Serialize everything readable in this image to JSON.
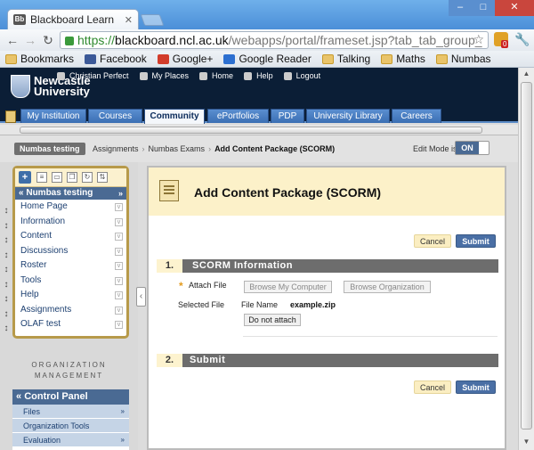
{
  "browser": {
    "tab_title": "Blackboard Learn",
    "tab_favicon": "Bb",
    "url": {
      "scheme": "https://",
      "host": "blackboard.ncl.ac.uk",
      "path": "/webapps/portal/frameset.jsp?tab_tab_group_"
    },
    "extension_badge": "0",
    "bookmarks": [
      {
        "label": "Bookmarks",
        "icon": "folder-icon"
      },
      {
        "label": "Facebook",
        "icon": "facebook-icon"
      },
      {
        "label": "Google+",
        "icon": "google-plus-icon"
      },
      {
        "label": "Google Reader",
        "icon": "google-reader-icon"
      },
      {
        "label": "Talking",
        "icon": "folder-icon"
      },
      {
        "label": "Maths",
        "icon": "folder-icon"
      },
      {
        "label": "Numbas",
        "icon": "folder-icon"
      }
    ]
  },
  "header": {
    "logo_line1": "Newcastle",
    "logo_line2": "University",
    "user": "Christian Perfect",
    "links": [
      "My Places",
      "Home",
      "Help",
      "Logout"
    ]
  },
  "tabs": [
    {
      "label": "My Institution",
      "active": false
    },
    {
      "label": "Courses",
      "active": false
    },
    {
      "label": "Community",
      "active": true
    },
    {
      "label": "ePortfolios",
      "active": false
    },
    {
      "label": "PDP",
      "active": false
    },
    {
      "label": "University Library",
      "active": false
    },
    {
      "label": "Careers",
      "active": false
    }
  ],
  "breadcrumb": {
    "course": "Numbas testing",
    "items": [
      "Assignments",
      "Numbas Exams"
    ],
    "current": "Add Content Package (SCORM)",
    "edit_mode_label": "Edit Mode is:",
    "edit_mode_value": "ON"
  },
  "course_menu": {
    "title": "Numbas testing",
    "items": [
      "Home Page",
      "Information",
      "Content",
      "Discussions",
      "Roster",
      "Tools",
      "Help",
      "Assignments",
      "OLAF test"
    ]
  },
  "org_management": {
    "line1": "ORGANIZATION",
    "line2": "MANAGEMENT"
  },
  "control_panel": {
    "title": "Control Panel",
    "items": [
      "Files",
      "Organization Tools",
      "Evaluation"
    ]
  },
  "page": {
    "title": "Add Content Package (SCORM)",
    "cancel_label": "Cancel",
    "submit_label": "Submit",
    "section1": {
      "number": "1.",
      "title": "SCORM Information"
    },
    "attach_file_label": "Attach File",
    "browse_computer_label": "Browse My Computer",
    "browse_org_label": "Browse Organization",
    "selected_file_label": "Selected File",
    "file_name_label": "File Name",
    "file_name_value": "example.zip",
    "do_not_attach_label": "Do not attach",
    "section2": {
      "number": "2.",
      "title": "Submit"
    }
  }
}
